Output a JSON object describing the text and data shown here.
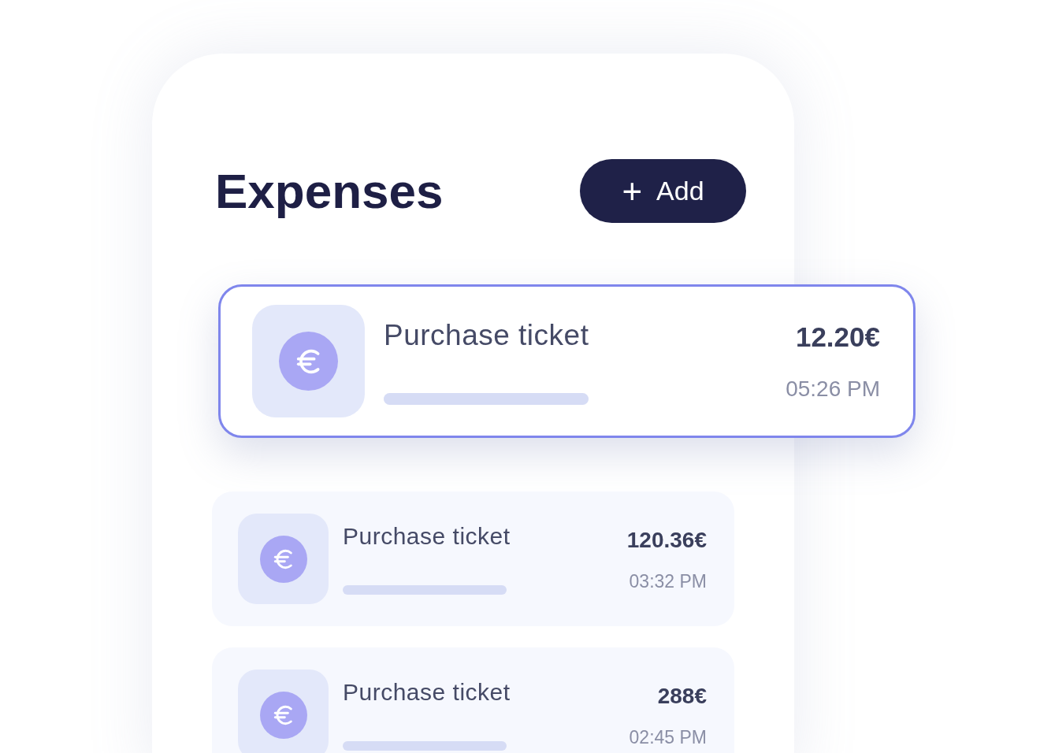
{
  "title": "Expenses",
  "add_button": {
    "icon": "+",
    "label": "Add"
  },
  "expenses": [
    {
      "title": "Purchase ticket",
      "amount": "12.20€",
      "time": "05:26 PM",
      "selected": true
    },
    {
      "title": "Purchase ticket",
      "amount": "120.36€",
      "time": "03:32 PM",
      "selected": false
    },
    {
      "title": "Purchase ticket",
      "amount": "288€",
      "time": "02:45 PM",
      "selected": false
    }
  ]
}
